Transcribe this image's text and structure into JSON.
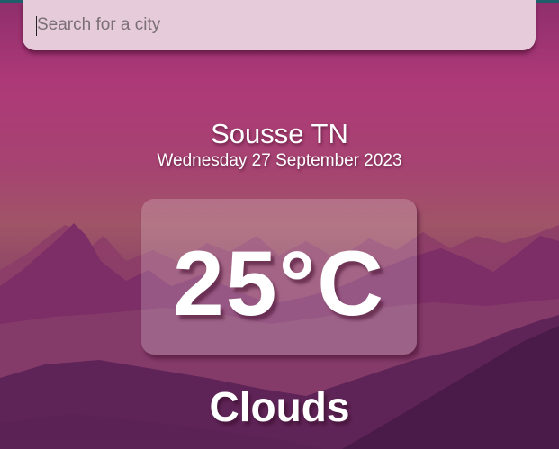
{
  "search": {
    "placeholder": "Search for a city",
    "value": ""
  },
  "location": {
    "city": "Sousse TN",
    "date": "Wednesday 27 September 2023"
  },
  "weather": {
    "temperature": "25°C",
    "condition": "Clouds"
  },
  "colors": {
    "sky_top": "#ab3877",
    "sky_horizon": "#9e4e63",
    "mountains_far": "#8a3f6a",
    "mountains_mid": "#7a2e66",
    "mountains_near": "#4e1d4c",
    "search_bg": "#e6ccdb",
    "text": "#ffffff"
  }
}
